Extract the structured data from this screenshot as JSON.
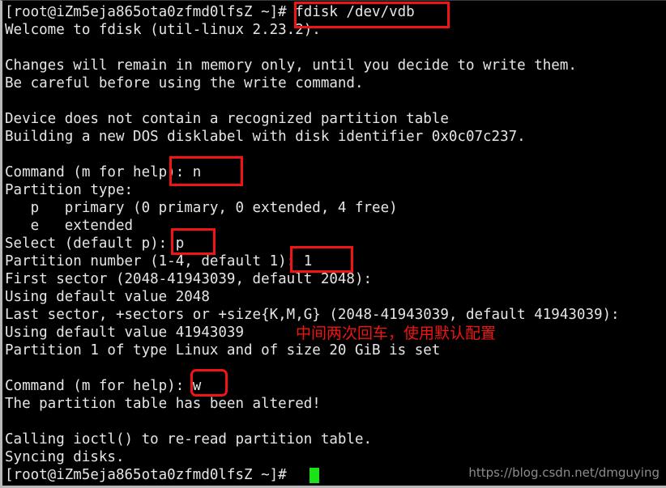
{
  "terminal": {
    "title": "fdisk session",
    "background_color": "#000000",
    "text_color": "#e6e6e6",
    "cursor_color": "#19e219",
    "annotation_color": "#f01414",
    "lines": [
      "[root@iZm5eja865ota0zfmd0lfsZ ~]# fdisk /dev/vdb",
      "Welcome to fdisk (util-linux 2.23.2).",
      "",
      "Changes will remain in memory only, until you decide to write them.",
      "Be careful before using the write command.",
      "",
      "Device does not contain a recognized partition table",
      "Building a new DOS disklabel with disk identifier 0x0c07c237.",
      "",
      "Command (m for help): n",
      "Partition type:",
      "   p   primary (0 primary, 0 extended, 4 free)",
      "   e   extended",
      "Select (default p): p",
      "Partition number (1-4, default 1): 1",
      "First sector (2048-41943039, default 2048):",
      "Using default value 2048",
      "Last sector, +sectors or +size{K,M,G} (2048-41943039, default 41943039):",
      "Using default value 41943039",
      "Partition 1 of type Linux and of size 20 GiB is set",
      "",
      "Command (m for help): w",
      "The partition table has been altered!",
      "",
      "Calling ioctl() to re-read partition table.",
      "Syncing disks.",
      "[root@iZm5eja865ota0zfmd0lfsZ ~]# "
    ]
  },
  "annotations": {
    "command_box_label": "fdisk /dev/vdb",
    "new_partition_box_label": "n",
    "primary_box_label": "p",
    "partition_number_box_label": "1",
    "write_box_label": "w",
    "chinese_note": "中间两次回车，使用默认配置"
  },
  "watermark": {
    "text": "https://blog.csdn.net/dmguying"
  }
}
